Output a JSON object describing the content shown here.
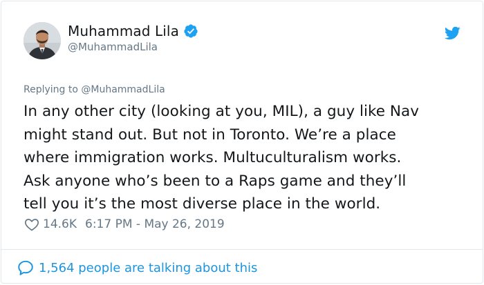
{
  "author": {
    "name": "Muhammad Lila",
    "handle": "@MuhammadLila",
    "verified_icon": "verified-badge-icon",
    "avatar": "avatar"
  },
  "brand": {
    "icon": "twitter-bird-icon",
    "color": "#1da1f2"
  },
  "tweet": {
    "replying_to": "Replying to @MuhammadLila",
    "text": "In any other city (looking at you, MIL), a guy like Nav\nmight stand out.  But not in Toronto.  We’re a place\nwhere immigration works.  Multuculturalism works.\nAsk anyone who’s been to a Raps game and they’ll\ntell you it’s the most diverse place in the world.",
    "likes": "14.6K",
    "timestamp": "6:17 PM - May 26, 2019"
  },
  "footer": {
    "talking": "1,564 people are talking about this"
  },
  "colors": {
    "text": "#14171a",
    "secondary": "#657786",
    "link": "#1b95e0",
    "border": "#e1e8ed"
  }
}
